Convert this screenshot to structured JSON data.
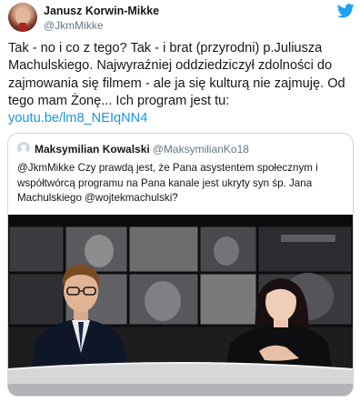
{
  "author": {
    "display_name": "Janusz Korwin-Mikke",
    "handle": "@JkmMikke"
  },
  "tweet": {
    "text": "Tak - no i co z tego? Tak - i brat (przyrodni) p.Juliusza Machulskiego. Najwyraźniej oddziedziczył zdolności do zajmowania się filmem - ale ja się kulturą nie zajmuję. Od tego mam Żonę... Ich program jest tu: ",
    "link": "youtu.be/lm8_NEIqNN4"
  },
  "quoted_tweet": {
    "display_name": "Maksymilian Kowalski",
    "handle": "@MaksymilianKo18",
    "text": "@JkmMikke Czy prawdą jest, że Pana asystentem społecznym i współtwórcą programu na Pana kanale jest ukryty syn śp. Jana Machulskiego @wojtekmachulski?"
  },
  "colors": {
    "link": "#1b95e0",
    "twitter_brand": "#1da1f2",
    "secondary_text": "#657786",
    "border": "#ccd6dd"
  },
  "icons": {
    "brand": "twitter-bird-icon",
    "author_avatar": "avatar",
    "quoted_avatar": "default-profile-icon"
  }
}
